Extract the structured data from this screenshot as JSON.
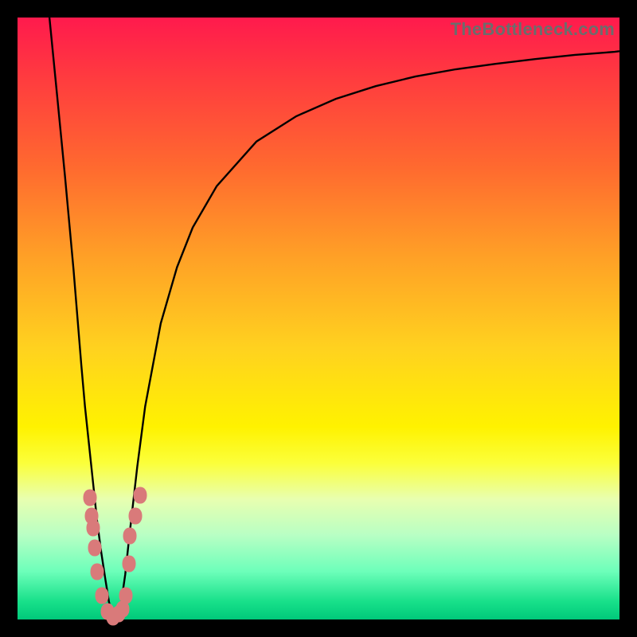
{
  "watermark": "TheBottleneck.com",
  "colors": {
    "page_bg": "#000000",
    "curve": "#000000",
    "dot": "#d97a7a",
    "watermark": "#6c6c6c"
  },
  "chart_data": {
    "type": "line",
    "title": "",
    "xlabel": "",
    "ylabel": "",
    "xlim": [
      0,
      100
    ],
    "ylim": [
      0,
      100
    ],
    "grid": false,
    "legend": false,
    "series": [
      {
        "name": "left-branch",
        "x": [
          5.3,
          6.6,
          7.9,
          9.3,
          10.6,
          11.2,
          11.9,
          12.6,
          13.2,
          13.9,
          14.6,
          15.2,
          15.9
        ],
        "y": [
          100,
          86.8,
          73.5,
          58.2,
          42.3,
          35.4,
          28.8,
          22.2,
          16.5,
          11.2,
          6.6,
          2.9,
          0.3
        ]
      },
      {
        "name": "right-branch",
        "x": [
          16.5,
          17.2,
          17.9,
          18.5,
          19.9,
          21.2,
          23.8,
          26.5,
          29.1,
          33.1,
          39.7,
          46.3,
          52.9,
          59.5,
          66.1,
          72.8,
          79.4,
          86.0,
          92.6,
          99.2,
          100
        ],
        "y": [
          0.3,
          2.6,
          7.5,
          13.2,
          25.4,
          35.4,
          49.2,
          58.5,
          65.1,
          72.0,
          79.4,
          83.6,
          86.5,
          88.6,
          90.2,
          91.4,
          92.3,
          93.1,
          93.8,
          94.3,
          94.4
        ]
      }
    ],
    "points": {
      "name": "markers",
      "x": [
        12.0,
        12.3,
        12.6,
        12.8,
        13.2,
        14.0,
        15.0,
        15.9,
        16.8,
        17.5,
        18.0,
        18.5,
        18.7,
        19.6,
        20.4
      ],
      "y": [
        20.2,
        17.2,
        15.2,
        11.9,
        7.9,
        4.0,
        1.3,
        0.4,
        0.9,
        1.7,
        4.0,
        9.3,
        13.9,
        17.2,
        20.6
      ]
    }
  }
}
